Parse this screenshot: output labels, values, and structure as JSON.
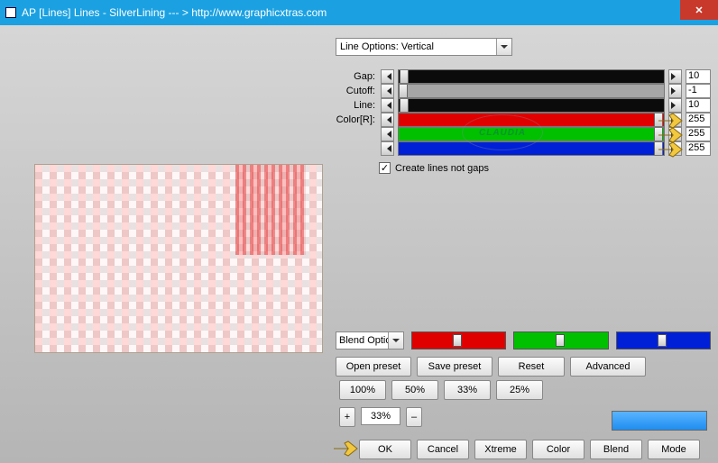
{
  "title": "AP [Lines]  Lines - SilverLining    --- >  http://www.graphicxtras.com",
  "dropdown": {
    "label": "Line Options: Vertical"
  },
  "sliders": {
    "gap": {
      "label": "Gap:",
      "value": "10"
    },
    "cutoff": {
      "label": "Cutoff:",
      "value": "-1"
    },
    "line": {
      "label": "Line:",
      "value": "10"
    },
    "colorR": {
      "label": "Color[R]:",
      "value": "255"
    },
    "colorG": {
      "label": "",
      "value": "255"
    },
    "colorB": {
      "label": "",
      "value": "255"
    }
  },
  "checkbox": {
    "create_lines": "Create lines not gaps",
    "checked": "✓"
  },
  "blend_dd": "Blend Option",
  "buttons": {
    "open": "Open preset",
    "save": "Save preset",
    "reset": "Reset",
    "adv": "Advanced",
    "p100": "100%",
    "p50": "50%",
    "p33": "33%",
    "p25": "25%",
    "plus": "+",
    "minus": "–",
    "pct": "33%",
    "ok": "OK",
    "cancel": "Cancel",
    "xtreme": "Xtreme",
    "color": "Color",
    "blend": "Blend",
    "mode": "Mode"
  },
  "watermark": "CLAUDIA"
}
